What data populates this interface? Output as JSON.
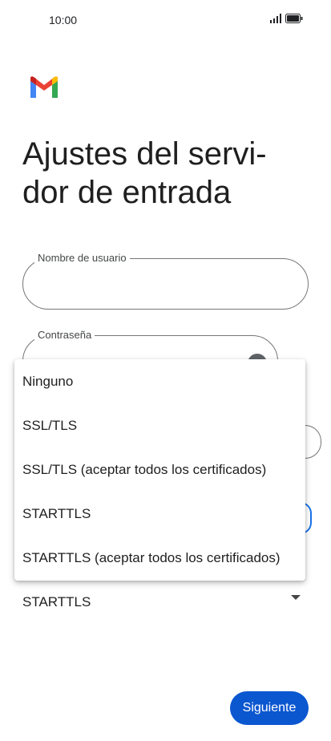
{
  "status_bar": {
    "time": "10:00"
  },
  "page": {
    "title": "Ajustes del servi- dor de entrada"
  },
  "form": {
    "username_label": "Nombre de usuario",
    "password_label": "Contraseña",
    "security_value": "STARTTLS"
  },
  "menu": {
    "items": [
      {
        "label": "Ninguno"
      },
      {
        "label": "SSL/TLS"
      },
      {
        "label": "SSL/TLS (aceptar todos los certificados)"
      },
      {
        "label": "STARTTLS"
      },
      {
        "label": "STARTTLS (aceptar todos los certificados)"
      }
    ]
  },
  "actions": {
    "next_label": "Siguiente"
  },
  "colors": {
    "accent": "#0b57d0",
    "outline": "#747775"
  },
  "icons": [
    "signal-icon",
    "battery-icon",
    "gmail-logo-icon",
    "visibility-icon",
    "chevron-down-icon"
  ]
}
